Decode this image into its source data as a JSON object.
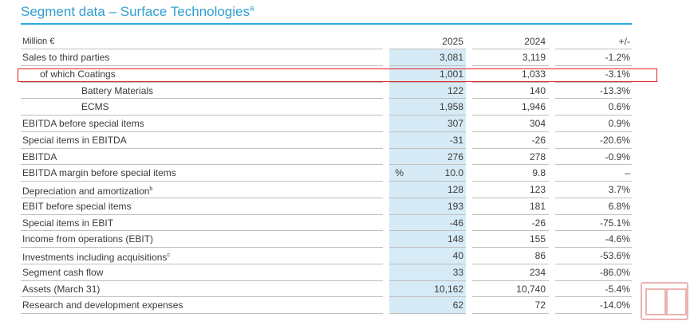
{
  "title": "Segment data – Surface Technologies",
  "title_footnote": "a",
  "header": {
    "label": "Million €",
    "col_2025": "2025",
    "col_2024": "2024",
    "col_change": "+/-"
  },
  "rows": [
    {
      "label": "Sales to third parties",
      "unit": "",
      "v2025": "3,081",
      "v2024": "3,119",
      "change": "-1.2%"
    },
    {
      "label": "of which Coatings",
      "unit": "",
      "v2025": "1,001",
      "v2024": "1,033",
      "change": "-3.1%"
    },
    {
      "label": "Battery Materials",
      "unit": "",
      "v2025": "122",
      "v2024": "140",
      "change": "-13.3%"
    },
    {
      "label": "ECMS",
      "unit": "",
      "v2025": "1,958",
      "v2024": "1,946",
      "change": "0.6%"
    },
    {
      "label": "EBITDA before special items",
      "unit": "",
      "v2025": "307",
      "v2024": "304",
      "change": "0.9%"
    },
    {
      "label": "Special items in EBITDA",
      "unit": "",
      "v2025": "-31",
      "v2024": "-26",
      "change": "-20.6%"
    },
    {
      "label": "EBITDA",
      "unit": "",
      "v2025": "276",
      "v2024": "278",
      "change": "-0.9%"
    },
    {
      "label": "EBITDA margin before special items",
      "unit": "%",
      "v2025": "10.0",
      "v2024": "9.8",
      "change": "–"
    },
    {
      "label": "Depreciation and amortization",
      "footnote": "b",
      "unit": "",
      "v2025": "128",
      "v2024": "123",
      "change": "3.7%"
    },
    {
      "label": "EBIT before special items",
      "unit": "",
      "v2025": "193",
      "v2024": "181",
      "change": "6.8%"
    },
    {
      "label": "Special items in EBIT",
      "unit": "",
      "v2025": "-46",
      "v2024": "-26",
      "change": "-75.1%"
    },
    {
      "label": "Income from operations (EBIT)",
      "unit": "",
      "v2025": "148",
      "v2024": "155",
      "change": "-4.6%"
    },
    {
      "label": "Investments including acquisitions",
      "footnote": "c",
      "unit": "",
      "v2025": "40",
      "v2024": "86",
      "change": "-53.6%"
    },
    {
      "label": "Segment cash flow",
      "unit": "",
      "v2025": "33",
      "v2024": "234",
      "change": "-86.0%"
    },
    {
      "label": "Assets (March 31)",
      "unit": "",
      "v2025": "10,162",
      "v2024": "10,740",
      "change": "-5.4%"
    },
    {
      "label": "Research and development expenses",
      "unit": "",
      "v2025": "62",
      "v2024": "72",
      "change": "-14.0%"
    }
  ],
  "colors": {
    "title": "#2f9fd0",
    "rule": "#29a9e1",
    "highlight_column": "#d6ebf5",
    "annotation_box": "#e02020"
  }
}
